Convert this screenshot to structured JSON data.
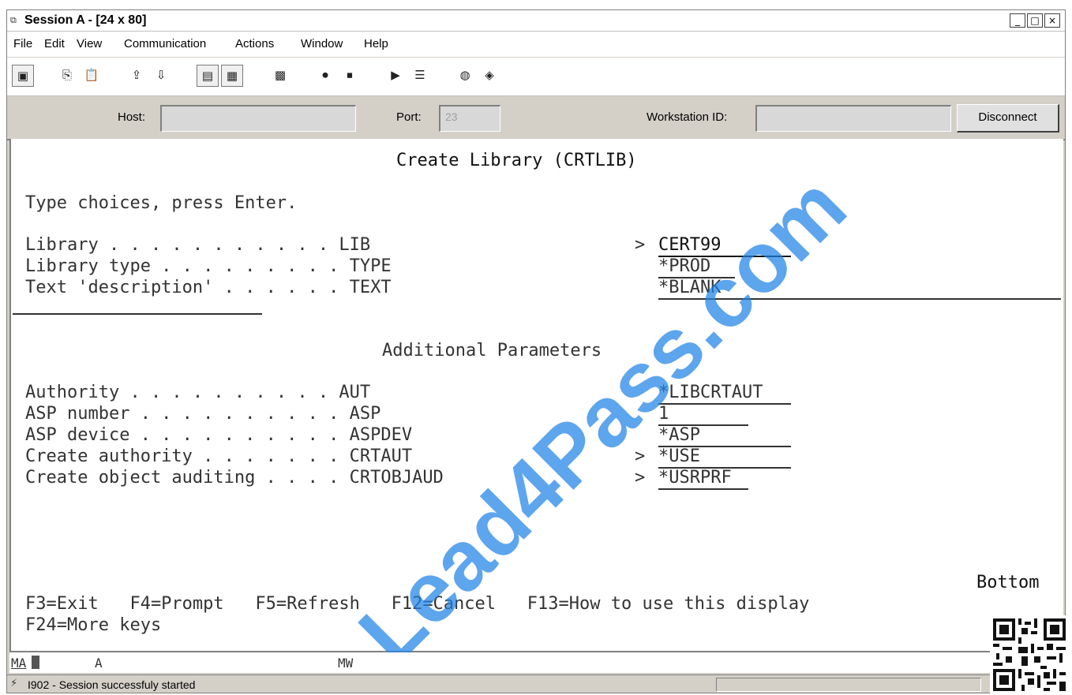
{
  "window": {
    "title": "Session A - [24 x 80]",
    "icon": "terminal-session-icon",
    "controls": {
      "minimize": "_",
      "maximize": "□",
      "close": "×"
    }
  },
  "menu": {
    "items": [
      "File",
      "Edit",
      "View",
      "Communication",
      "Actions",
      "Window",
      "Help"
    ]
  },
  "toolbar": {
    "buttons": [
      {
        "name": "print-screen-icon",
        "glyph": "▣"
      },
      {
        "name": "copy-icon",
        "glyph": "⎘"
      },
      {
        "name": "paste-icon",
        "glyph": "📋"
      },
      {
        "name": "send-file-icon",
        "glyph": "⇪"
      },
      {
        "name": "receive-file-icon",
        "glyph": "⇩"
      },
      {
        "name": "display-icon",
        "glyph": "▤"
      },
      {
        "name": "keypad-icon",
        "glyph": "▦"
      },
      {
        "name": "macro-icon",
        "glyph": "▩"
      },
      {
        "name": "record-macro-icon",
        "glyph": "⏺"
      },
      {
        "name": "stop-macro-icon",
        "glyph": "⏹"
      },
      {
        "name": "play-macro-icon",
        "glyph": "▶"
      },
      {
        "name": "macro-list-icon",
        "glyph": "☰"
      },
      {
        "name": "globe-icon",
        "glyph": "◍"
      },
      {
        "name": "tag-icon",
        "glyph": "◈"
      }
    ]
  },
  "connection": {
    "host_label": "Host:",
    "host_value": "",
    "port_label": "Port:",
    "port_value": "23",
    "workstation_label": "Workstation ID:",
    "workstation_value": "",
    "disconnect_label": "Disconnect"
  },
  "screen": {
    "title": "Create Library (CRTLIB)",
    "instructions": "Type choices, press Enter.",
    "params": [
      {
        "label": "Library . . . . . . . . . . . LIB",
        "prefix": ">",
        "value": "CERT99"
      },
      {
        "label": "Library type . . . . . . . . . TYPE",
        "prefix": "",
        "value": "*PROD"
      },
      {
        "label": "Text 'description' . . . . . . TEXT",
        "prefix": "",
        "value": "*BLANK"
      }
    ],
    "additional_title": "Additional Parameters",
    "additional_params": [
      {
        "label": "Authority . . . . . . . . . . AUT",
        "prefix": "",
        "value": "*LIBCRTAUT"
      },
      {
        "label": "ASP number . . . . . . . . . . ASP",
        "prefix": "",
        "value": "1"
      },
      {
        "label": "ASP device . . . . . . . . . . ASPDEV",
        "prefix": "",
        "value": "*ASP"
      },
      {
        "label": "Create authority . . . . . . . CRTAUT",
        "prefix": ">",
        "value": "*USE"
      },
      {
        "label": "Create object auditing . . . . CRTOBJAUD",
        "prefix": ">",
        "value": "*USRPRF"
      }
    ],
    "bottom_marker": "Bottom",
    "function_keys_line1": "F3=Exit   F4=Prompt   F5=Refresh   F12=Cancel   F13=How to use this display",
    "function_keys_line2": "F24=More keys"
  },
  "watermark": "Lead4Pass.com",
  "oia": {
    "ma": "MA",
    "mode": "A",
    "mw": "MW"
  },
  "status": {
    "text": "I902 - Session successfuly started"
  }
}
